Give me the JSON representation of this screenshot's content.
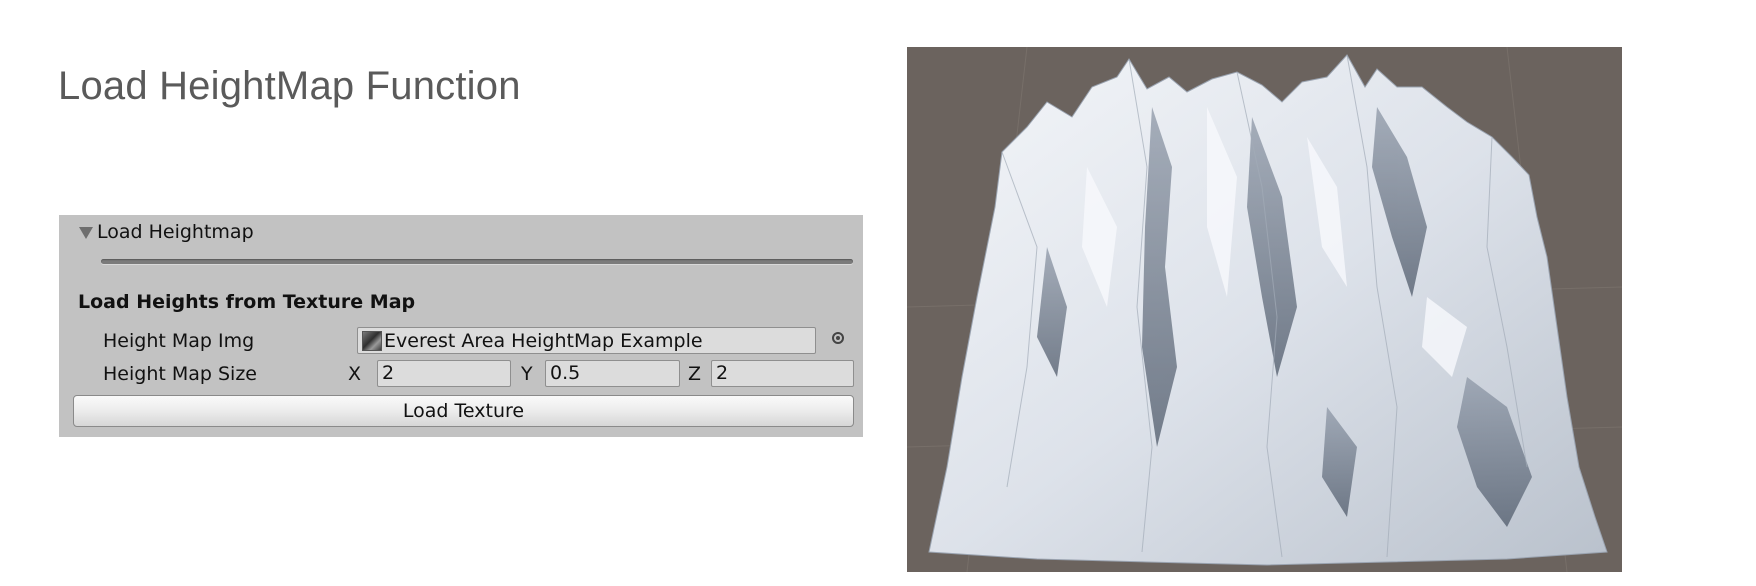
{
  "page": {
    "title": "Load HeightMap Function"
  },
  "inspector": {
    "foldout_label": "Load Heightmap",
    "section_header": "Load Heights from Texture Map",
    "height_map_img": {
      "label": "Height Map Img",
      "value": "Everest Area HeightMap Example",
      "icon": "texture-thumbnail-icon",
      "picker_icon": "object-picker-icon"
    },
    "height_map_size": {
      "label": "Height Map Size",
      "x_label": "X",
      "x_value": "2",
      "y_label": "Y",
      "y_value": "0.5",
      "z_label": "Z",
      "z_value": "2"
    },
    "load_button_label": "Load Texture"
  },
  "viewport": {
    "content": "terrain-mesh",
    "background_color": "#6b635e",
    "terrain_color": "#e6eaf0"
  }
}
